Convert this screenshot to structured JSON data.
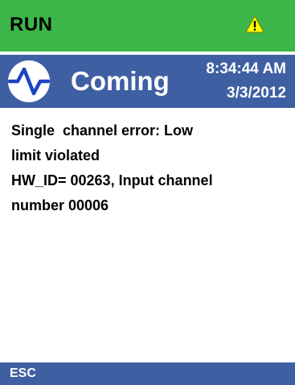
{
  "status_bar": {
    "mode": "RUN",
    "warning_icon": "warning-triangle-icon",
    "color": "#3cb648"
  },
  "header": {
    "state_icon": "pulse-wave-icon",
    "state": "Coming",
    "time": "8:34:44 AM",
    "date": "3/3/2012",
    "color": "#3f5fa3"
  },
  "message": {
    "lines": [
      "Single  channel error: Low",
      "limit violated",
      "HW_ID= 00263, Input channel",
      "number 00006"
    ]
  },
  "softkeys": {
    "esc_label": "ESC"
  }
}
